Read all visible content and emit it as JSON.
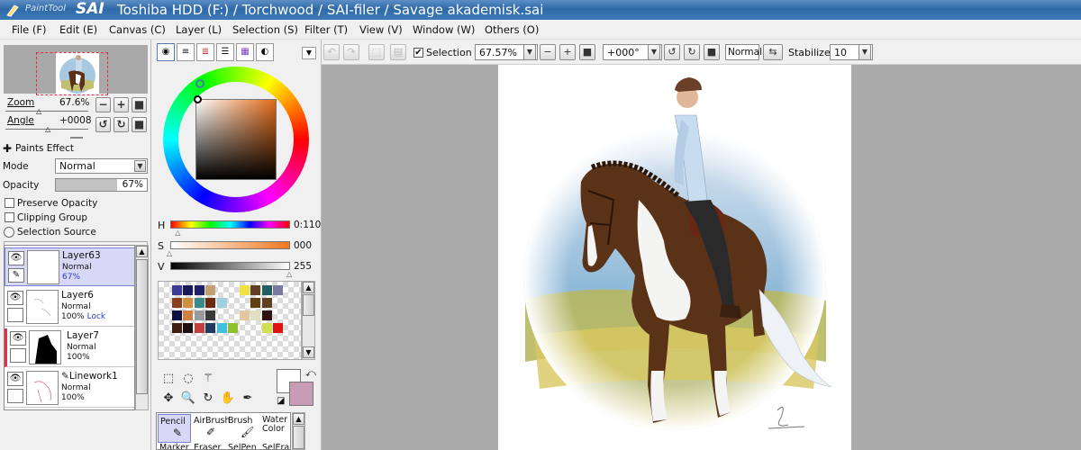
{
  "window": {
    "app_logo_sub": "PaintTool",
    "app_logo_main": "SAI",
    "title": "Toshiba HDD (F:) / Torchwood / SAI-filer / Savage akademisk.sai"
  },
  "menu": [
    {
      "label": "File (F)"
    },
    {
      "label": "Edit (E)"
    },
    {
      "label": "Canvas (C)"
    },
    {
      "label": "Layer (L)"
    },
    {
      "label": "Selection (S)"
    },
    {
      "label": "Filter (T)"
    },
    {
      "label": "View (V)"
    },
    {
      "label": "Window (W)"
    },
    {
      "label": "Others (O)"
    }
  ],
  "navigator": {
    "zoom_label": "Zoom",
    "zoom_value": "67.6%",
    "angle_label": "Angle",
    "angle_value": "+0008",
    "zoom_level_fraction": 0.676
  },
  "layer_props": {
    "paints_effect": "Paints Effect",
    "mode_label": "Mode",
    "mode_value": "Normal",
    "opacity_label": "Opacity",
    "opacity_value": "67%",
    "opacity_fraction": 0.67,
    "preserve_opacity": "Preserve Opacity",
    "clipping_group": "Clipping Group",
    "selection_source": "Selection Source"
  },
  "layers": [
    {
      "name": "Layer63",
      "mode": "Normal",
      "opacity": "67%",
      "lock": "",
      "selected": true
    },
    {
      "name": "Layer6",
      "mode": "Normal",
      "opacity": "100%",
      "lock": "Lock",
      "selected": false
    },
    {
      "name": "Layer7",
      "mode": "Normal",
      "opacity": "100%",
      "lock": "",
      "selected": false
    },
    {
      "name": "Linework1",
      "mode": "Normal",
      "opacity": "100%",
      "lock": "",
      "selected": false
    }
  ],
  "color": {
    "h_label": "H",
    "h_value": "0:110",
    "s_label": "S",
    "s_value": "000",
    "v_label": "V",
    "v_value": "255",
    "h_fraction": 0.07,
    "s_fraction": 0.0,
    "v_fraction": 1.0,
    "primary": "#ffffff",
    "secondary": "#c89cb4",
    "swatches": [
      "#3a3a9a",
      "#1a1a5a",
      "#202068",
      "#c0a070",
      "#f0e040",
      "#604020",
      "#206060",
      "#7a7aa0",
      "#8a4020",
      "#d09040",
      "#3a8a8a",
      "#6a2a10",
      "#a0d0e0",
      "#604010",
      "#604020",
      "#101040",
      "#d08040",
      "#9a9aa0",
      "#3a3a3a",
      "#e0c8a0",
      "#e0e0c0",
      "#301010",
      "#402010",
      "#201010",
      "#c04040",
      "#203a60",
      "#40c0e0",
      "#90c030",
      "#d0e050",
      "#e01010"
    ]
  },
  "tools": {
    "brushes": [
      "Pencil",
      "AirBrush",
      "Brush",
      "Water Color"
    ],
    "brushes_row2": [
      "Marker",
      "Eraser",
      "SelPen",
      "SelEras"
    ]
  },
  "toolbar": {
    "selection_label": "Selection",
    "zoom_value": "67.57%",
    "angle_value": "+000°",
    "blend_mode": "Normal",
    "stabilizer_label": "Stabilizer",
    "stabilizer_value": "10"
  },
  "canvas": {
    "background": "#ababab",
    "page_color": "#ffffff"
  }
}
